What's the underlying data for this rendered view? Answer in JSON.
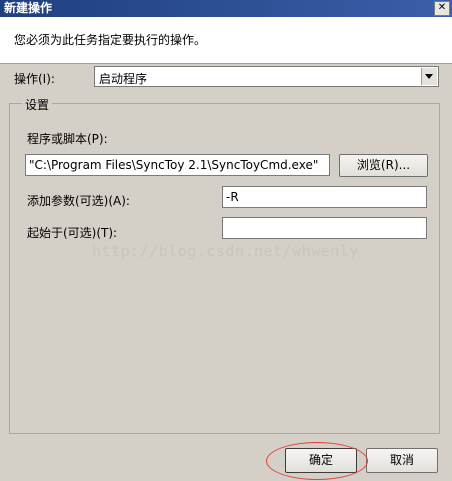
{
  "window": {
    "title": "新建操作",
    "close_glyph": "✕"
  },
  "description": "您必须为此任务指定要执行的操作。",
  "action": {
    "label": "操作(I):",
    "value": "启动程序"
  },
  "settings": {
    "group_label": "设置",
    "program_label": "程序或脚本(P):",
    "program_value": "\"C:\\Program Files\\SyncToy 2.1\\SyncToyCmd.exe\"",
    "browse_label": "浏览(R)...",
    "args_label": "添加参数(可选)(A):",
    "args_value": "-R",
    "start_label": "起始于(可选)(T):",
    "start_value": ""
  },
  "watermark": "http://blog.csdn.net/whwenly",
  "buttons": {
    "ok": "确定",
    "cancel": "取消"
  },
  "colors": {
    "title_bar": "#1f3f7f",
    "highlight_ellipse": "#e2403a"
  }
}
